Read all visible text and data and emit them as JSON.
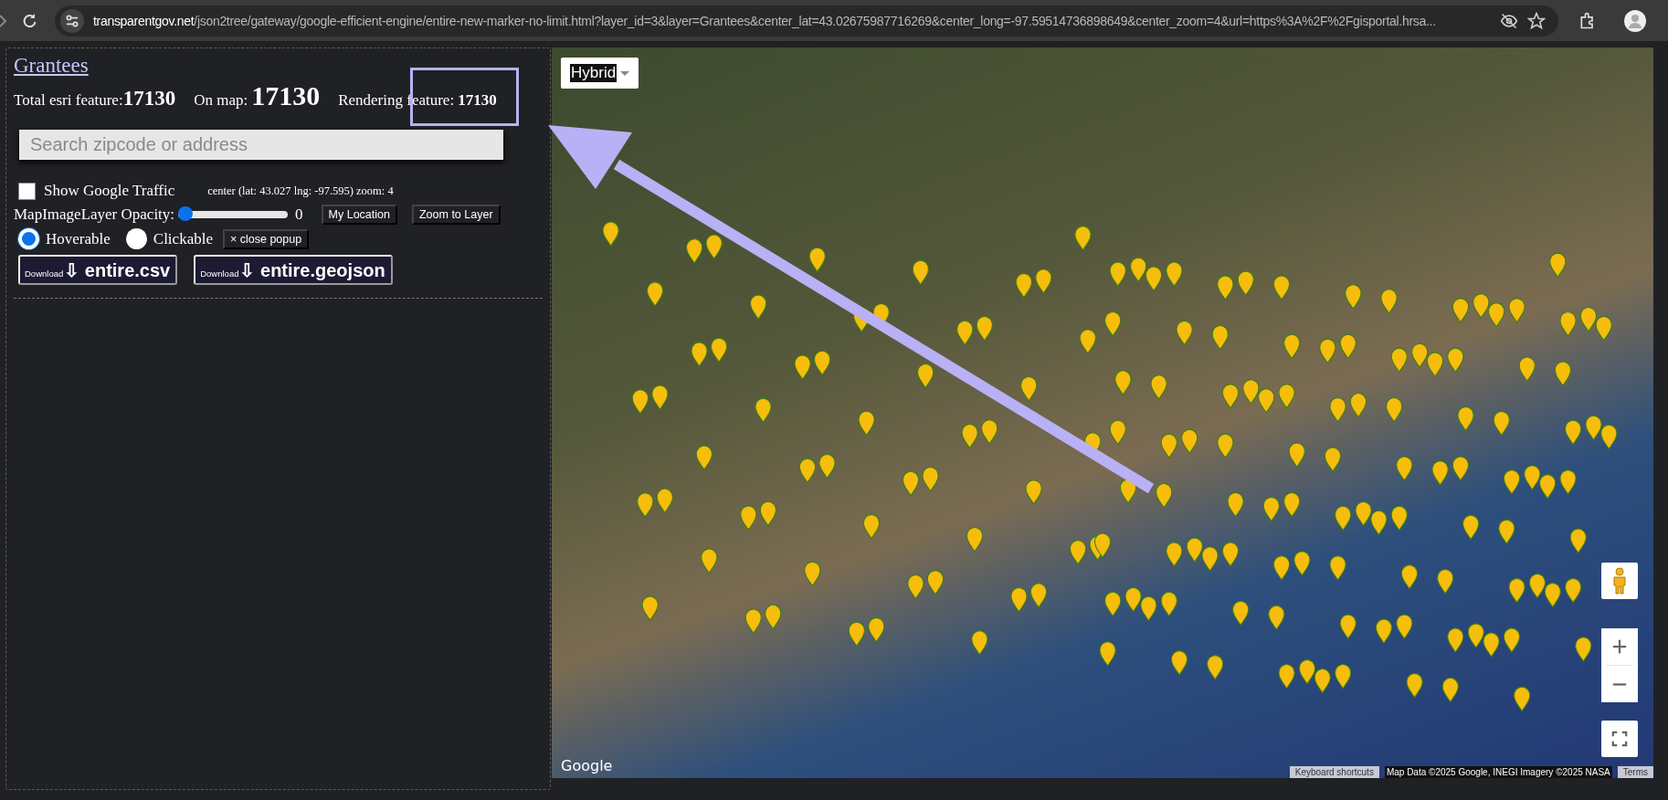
{
  "browser": {
    "url_host": "transparentgov.net",
    "url_path": "/json2tree/gateway/google-efficient-engine/entire-new-marker-no-limit.html?layer_id=3&layer=Grantees&center_lat=43.02675987716269&center_long=-97.59514736898649&center_zoom=4&url=https%3A%2F%2Fgisportal.hrsa..."
  },
  "panel": {
    "title": "Grantees",
    "stats": [
      {
        "label": "Total esri feature:",
        "value": "17130",
        "kind": "medium"
      },
      {
        "label": "On map:",
        "value": "17130",
        "kind": "large"
      },
      {
        "label": "Rendering feature:",
        "value": "17130",
        "kind": "small"
      }
    ],
    "search": {
      "placeholder": "Search zipcode or address"
    },
    "traffic": {
      "label": "Show Google Traffic",
      "checked": false
    },
    "center_info": "center (lat: 43.027 lng: -97.595) zoom: 4",
    "opacity": {
      "label": "MapImageLayer Opacity:",
      "level": 0,
      "reading": "0"
    },
    "buttons": [
      "My Location",
      "Zoom to Layer"
    ],
    "modes": [
      {
        "label": "Hoverable",
        "selected": true
      },
      {
        "label": "Clickable",
        "selected": false
      }
    ],
    "close_popup": "× close popup",
    "downloads": [
      {
        "prefix": "Download",
        "arrow": "⇩",
        "file": "entire.csv"
      },
      {
        "prefix": "Download",
        "arrow": "⇩",
        "file": "entire.geojson"
      }
    ]
  },
  "map": {
    "map_type": "Hybrid",
    "logo": "Google",
    "attribution": [
      {
        "text": "Keyboard shortcuts",
        "kind": "link"
      },
      {
        "text": "Map Data ©2025 Google, INEGI Imagery ©2025 NASA",
        "kind": "data"
      },
      {
        "text": "Terms",
        "kind": "link"
      }
    ]
  }
}
